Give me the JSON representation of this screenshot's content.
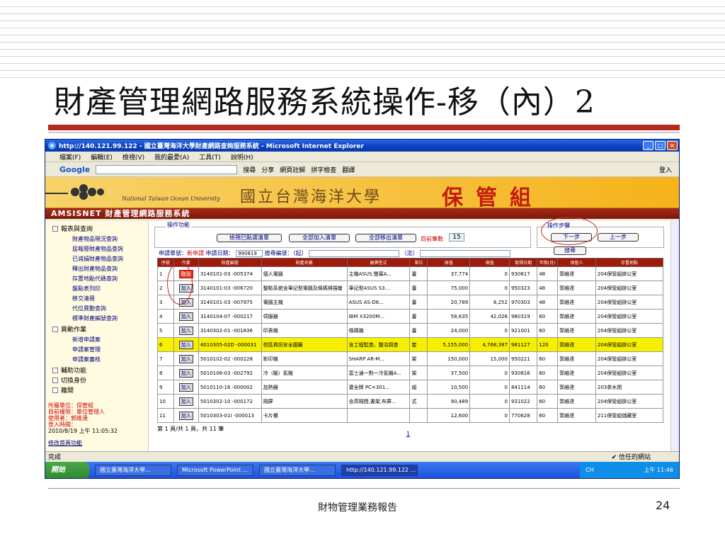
{
  "slide": {
    "title": "財產管理網路服務系統操作-移（內）2",
    "footer": "財物管理業務報告",
    "page_number": "24"
  },
  "browser": {
    "window_title": "http://140.121.99.122 - 國立臺灣海洋大學財產網路查詢服務系統 - Microsoft Internet Explorer",
    "menu": [
      "檔案(F)",
      "編輯(E)",
      "檢視(V)",
      "我的最愛(A)",
      "工具(T)",
      "說明(H)"
    ],
    "google_label": "Google",
    "toolbar": [
      "搜尋",
      "分享",
      "網頁註解",
      "拼字檢查",
      "翻譯",
      "登入"
    ],
    "status_left": "完成",
    "status_zone": "信任的網站"
  },
  "banner": {
    "university_en": "National Taiwan Ocean University",
    "university_zh": "國立台灣海洋大學",
    "department": "保管組",
    "system_name": "AMSISNET 財產管理網路服務系統"
  },
  "sidebar": {
    "sections": [
      {
        "label": "報表與查詢",
        "items": [
          "財產物品現況查詢",
          "屆報廢財產物品查詢",
          "已減損財產物品查詢",
          "釋出財產物品查詢",
          "存置地點代碼查詢",
          "盤點表列印",
          "移交清冊",
          "代位異動查詢",
          "標準財產編號查詢"
        ]
      },
      {
        "label": "異動作業",
        "items": [
          "新增申請案",
          "申請案管理",
          "申請案審核"
        ]
      },
      {
        "label": "輔助功能",
        "items": []
      },
      {
        "label": "切換身份",
        "items": []
      },
      {
        "label": "離開",
        "items": []
      }
    ],
    "info": {
      "unit": "所屬單位：保管組",
      "role": "目前權限：單位管理人",
      "user": "使用者：郭維達",
      "login_label": "登入時間：",
      "login_time": "2010/8/19 上午 11:05:32"
    },
    "link": "修改首頁功能"
  },
  "ops": {
    "label": "操作功能",
    "buttons": [
      "檢視已點選清單",
      "全部加入清單",
      "全部移出清單"
    ],
    "count_label": "目前筆數",
    "count": "15",
    "steps_label": "操作步驟",
    "next": "下一步",
    "prev": "上一步"
  },
  "search": {
    "prefix": "申請單號：",
    "type": "新申請",
    "date_label": "申請日期：",
    "date": "990819",
    "code_label": "搜尋編號：（起）",
    "to_label": "（迄）",
    "button": "搜尋"
  },
  "table": {
    "headers": [
      "序號",
      "作業",
      "財產編號",
      "財產名稱",
      "廠牌型式",
      "單位",
      "原值",
      "現值",
      "取得日期",
      "年限(月)",
      "保管人",
      "存置地點"
    ],
    "rows": [
      {
        "no": "1",
        "action": "取消",
        "code": "3140101-03 -005374",
        "name": "個人電腦",
        "brand": "主機ASUS,螢幕A...",
        "unit": "臺",
        "orig": "37,774",
        "cur": "0",
        "date": "930617",
        "life": "48",
        "keeper": "郭維達",
        "loc": "204保管組辦公室"
      },
      {
        "no": "2",
        "action": "加入",
        "code": "3140101-03 -006720",
        "name": "整點系統含筆記型電腦及條碼掃描槍",
        "brand": "筆記型ASUS S3...",
        "unit": "臺",
        "orig": "75,000",
        "cur": "0",
        "date": "950323",
        "life": "48",
        "keeper": "郭維達",
        "loc": "204保管組辦公室"
      },
      {
        "no": "3",
        "action": "加入",
        "code": "3140101-03 -007975",
        "name": "電腦主機",
        "brand": "ASUS AS-D6...",
        "unit": "臺",
        "orig": "20,789",
        "cur": "8,252",
        "date": "970303",
        "life": "48",
        "keeper": "郭維達",
        "loc": "204保管組辦公室"
      },
      {
        "no": "4",
        "action": "加入",
        "code": "3140104-07 -000217",
        "name": "伺服器",
        "brand": "IBM X3200M...",
        "unit": "臺",
        "orig": "58,635",
        "cur": "42,026",
        "date": "980319",
        "life": "60",
        "keeper": "郭維達",
        "loc": "204保管組辦公室"
      },
      {
        "no": "5",
        "action": "加入",
        "code": "3140302-01 -001836",
        "name": "印表機",
        "brand": "條碼機",
        "unit": "臺",
        "orig": "24,000",
        "cur": "0",
        "date": "921001",
        "life": "60",
        "keeper": "郭維達",
        "loc": "204保管組辦公室"
      },
      {
        "no": "6",
        "action": "加入",
        "code": "4010305-02D -000031",
        "name": "校區資訊安全圍籬",
        "brand": "含工程監造、整治調查",
        "unit": "套",
        "orig": "5,155,000",
        "cur": "4,768,387",
        "date": "981127",
        "life": "120",
        "keeper": "郭維達",
        "loc": "204保管組辦公室"
      },
      {
        "no": "7",
        "action": "加入",
        "code": "5010102-02 -000228",
        "name": "影印機",
        "brand": "SHARP AR-M...",
        "unit": "架",
        "orig": "150,000",
        "cur": "15,000",
        "date": "950221",
        "life": "60",
        "keeper": "郭維達",
        "loc": "204保管組辦公室"
      },
      {
        "no": "8",
        "action": "加入",
        "code": "5010106-03 -002792",
        "name": "冷（暖）氣機",
        "brand": "富士通一對一冷氣機A...",
        "unit": "架",
        "orig": "37,500",
        "cur": "0",
        "date": "930816",
        "life": "60",
        "keeper": "郭維達",
        "loc": "204保管組辦公室"
      },
      {
        "no": "9",
        "action": "加入",
        "code": "5010110-16 -000002",
        "name": "加熱器",
        "brand": "寶全牌 PC=301...",
        "unit": "組",
        "orig": "10,500",
        "cur": "0",
        "date": "841114",
        "life": "60",
        "keeper": "郭維達",
        "loc": "203茶水間"
      },
      {
        "no": "10",
        "action": "加入",
        "code": "5010302-10 -000172",
        "name": "隔屏",
        "brand": "含高隔間,書架,布屏...",
        "unit": "式",
        "orig": "90,489",
        "cur": "0",
        "date": "931022",
        "life": "60",
        "keeper": "郭維達",
        "loc": "204保管組辦公室"
      },
      {
        "no": "11",
        "action": "加入",
        "code": "5010303-01I -000013",
        "name": "卡片櫃",
        "brand": "",
        "unit": "",
        "orig": "12,600",
        "cur": "0",
        "date": "770628",
        "life": "60",
        "keeper": "郭維達",
        "loc": "211保管組儲藏室"
      }
    ],
    "page_info": "第 1 頁/共 1 頁，共 11 筆",
    "pager": "1"
  },
  "taskbar": {
    "start": "開始",
    "tasks": [
      "國立臺灣海洋大學...",
      "Microsoft PowerPoint ...",
      "國立臺灣海洋大學...",
      "http://140.121.99.122 ..."
    ],
    "clock": "上午 11:46",
    "lang": "CH"
  }
}
